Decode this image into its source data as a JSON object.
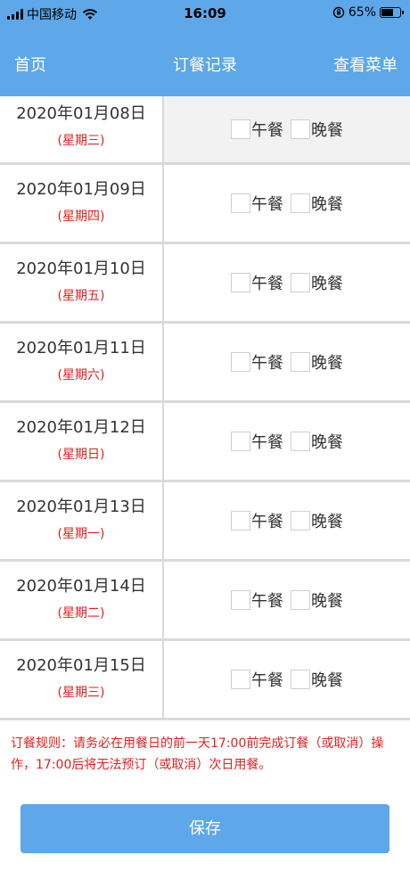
{
  "status_bar": {
    "carrier": "中国移动",
    "time": "16:09",
    "battery": "65%",
    "battery_level": 0.65,
    "icons": [
      "signal-icon",
      "wifi-icon",
      "orientation-lock-icon",
      "battery-icon"
    ]
  },
  "nav": {
    "left": "首页",
    "title": "订餐记录",
    "right": "查看菜单"
  },
  "meal_labels": {
    "lunch": "午餐",
    "dinner": "晚餐"
  },
  "records": [
    {
      "date": "2020年01月08日",
      "weekday": "(星期三)",
      "lunch_checked": false,
      "dinner_checked": false
    },
    {
      "date": "2020年01月09日",
      "weekday": "(星期四)",
      "lunch_checked": false,
      "dinner_checked": false
    },
    {
      "date": "2020年01月10日",
      "weekday": "(星期五)",
      "lunch_checked": false,
      "dinner_checked": false
    },
    {
      "date": "2020年01月11日",
      "weekday": "(星期六)",
      "lunch_checked": false,
      "dinner_checked": false
    },
    {
      "date": "2020年01月12日",
      "weekday": "(星期日)",
      "lunch_checked": false,
      "dinner_checked": false
    },
    {
      "date": "2020年01月13日",
      "weekday": "(星期一)",
      "lunch_checked": false,
      "dinner_checked": false
    },
    {
      "date": "2020年01月14日",
      "weekday": "(星期二)",
      "lunch_checked": false,
      "dinner_checked": false
    },
    {
      "date": "2020年01月15日",
      "weekday": "(星期三)",
      "lunch_checked": false,
      "dinner_checked": false
    }
  ],
  "rules": "订餐规则：请务必在用餐日的前一天17:00前完成订餐（或取消）操作，17:00后将无法预订（或取消）次日用餐。",
  "save_label": "保存",
  "colors": {
    "primary": "#5ea7e8",
    "warning": "#e02020"
  }
}
